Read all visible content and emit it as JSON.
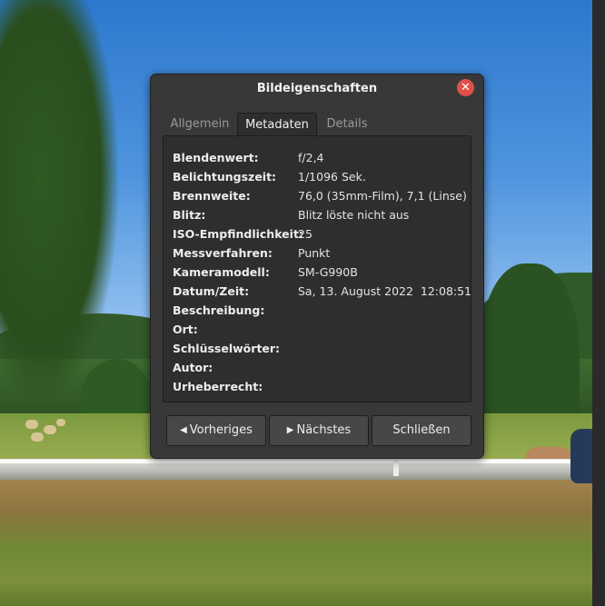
{
  "dialog": {
    "title": "Bildeigenschaften",
    "close_icon": "close-icon",
    "tabs": [
      {
        "label": "Allgemein",
        "active": false
      },
      {
        "label": "Metadaten",
        "active": true
      },
      {
        "label": "Details",
        "active": false
      }
    ],
    "fields": [
      {
        "label": "Blendenwert:",
        "value": "f/2,4"
      },
      {
        "label": "Belichtungszeit:",
        "value": "1/1096 Sek."
      },
      {
        "label": "Brennweite:",
        "value": "76,0 (35mm-Film), 7,1 (Linse)"
      },
      {
        "label": "Blitz:",
        "value": "Blitz löste nicht aus"
      },
      {
        "label": "ISO-Empfindlichkeit:",
        "value": "25"
      },
      {
        "label": "Messverfahren:",
        "value": "Punkt"
      },
      {
        "label": "Kameramodell:",
        "value": "SM-G990B"
      },
      {
        "label": "Datum/Zeit:",
        "value": "Sa, 13. August 2022  12:08:51"
      },
      {
        "label": "Beschreibung:",
        "value": ""
      },
      {
        "label": "Ort:",
        "value": ""
      },
      {
        "label": "Schlüsselwörter:",
        "value": ""
      },
      {
        "label": "Autor:",
        "value": ""
      },
      {
        "label": "Urheberrecht:",
        "value": ""
      }
    ],
    "buttons": {
      "prev_label": "Vorheriges",
      "next_label": "Nächstes",
      "close_label": "Schließen"
    },
    "icons": {
      "prev": "arrow-left-icon",
      "next": "arrow-right-icon"
    }
  },
  "colors": {
    "dialog_bg": "#383838",
    "panel_bg": "#2e2e2e",
    "close_button": "#e0504a"
  }
}
